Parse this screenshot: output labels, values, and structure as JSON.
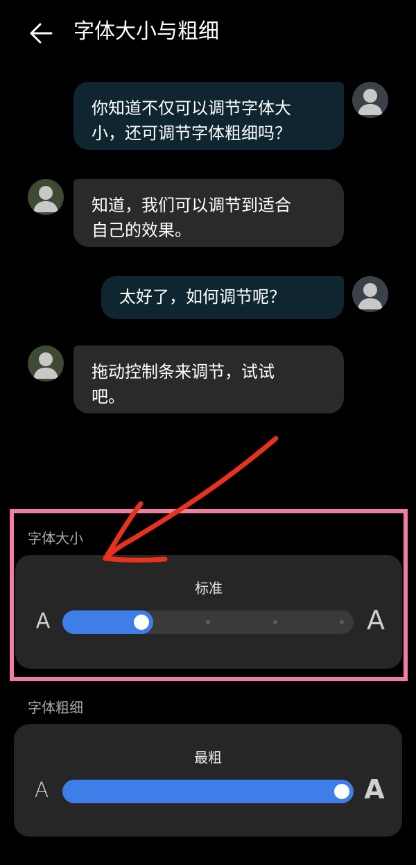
{
  "header": {
    "title": "字体大小与粗细"
  },
  "chat": [
    {
      "side": "me",
      "text_lines": [
        "你知道不仅可以调节字体大",
        "小，还可调节字体粗细吗？"
      ]
    },
    {
      "side": "other",
      "text_lines": [
        "知道，我们可以调节到适合",
        "自己的效果。"
      ]
    },
    {
      "side": "me",
      "text_lines": [
        "太好了，如何调节呢？"
      ]
    },
    {
      "side": "other",
      "text_lines": [
        "拖动控制条来调节，试试",
        "吧。"
      ]
    }
  ],
  "font_size": {
    "label": "字体大小",
    "value": "标准",
    "small_glyph": "A",
    "large_glyph": "A",
    "level": 0.25
  },
  "font_weight": {
    "label": "字体粗细",
    "value": "最粗",
    "small_glyph": "A",
    "large_glyph": "A",
    "level": 1.0
  },
  "colors": {
    "accent": "#3d7ee8",
    "highlight_border": "#f07ea0",
    "annotation_arrow": "#e8321e"
  }
}
